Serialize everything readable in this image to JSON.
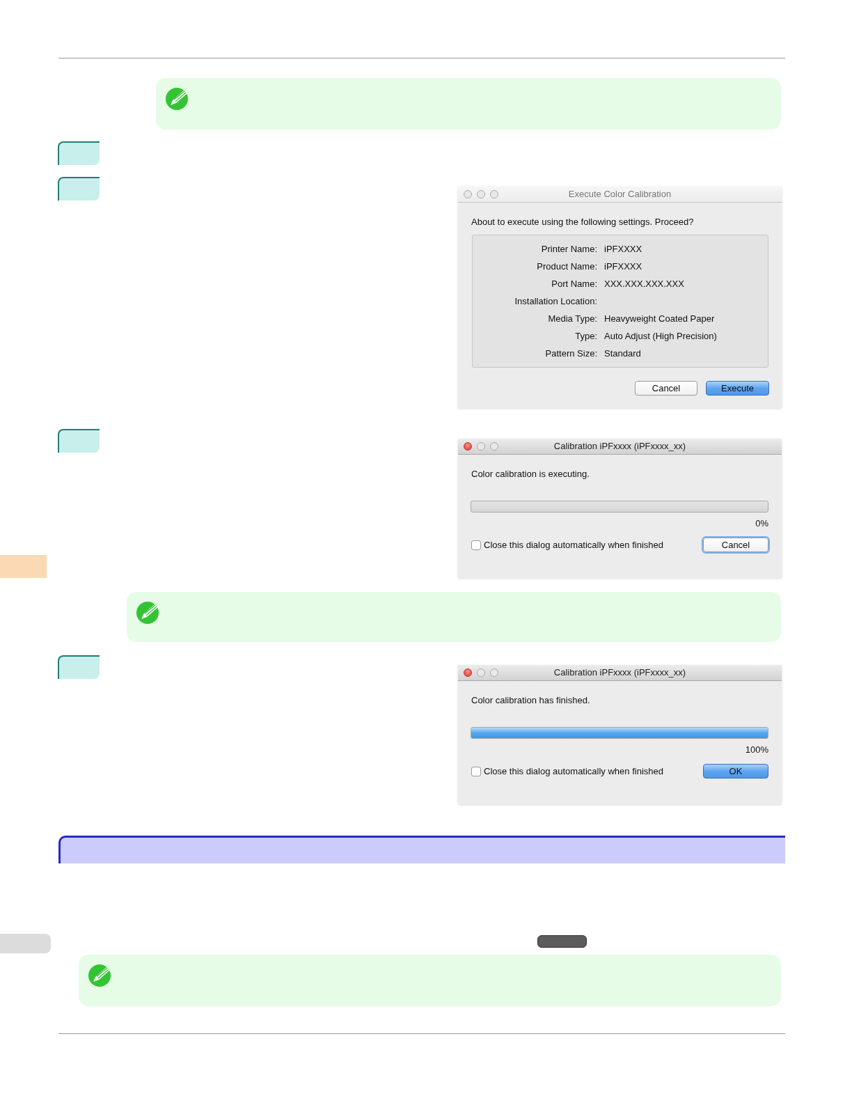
{
  "dialogs": [
    {
      "kind": "confirm",
      "title": "Execute Color Calibration",
      "active": false,
      "message": "About to execute using the following settings. Proceed?",
      "settings": [
        {
          "label": "Printer Name:",
          "value": "iPFXXXX"
        },
        {
          "label": "Product Name:",
          "value": "iPFXXXX"
        },
        {
          "label": "Port Name:",
          "value": "XXX.XXX.XXX.XXX"
        },
        {
          "label": "Installation Location:"
        },
        {
          "label": "Media Type:",
          "value": "Heavyweight Coated Paper"
        },
        {
          "label": "Type:",
          "value": "Auto Adjust (High Precision)"
        },
        {
          "label": "Pattern Size:",
          "value": "Standard"
        }
      ],
      "buttons": [
        {
          "label": "Cancel",
          "default": false,
          "focused": false
        },
        {
          "label": "Execute",
          "default": true,
          "focused": false
        }
      ]
    },
    {
      "kind": "progress",
      "title": "Calibration iPFxxxx (iPFxxxx_xx)",
      "active": true,
      "message": "Color calibration is executing.",
      "level": 0,
      "reading": "0%",
      "checkbox": {
        "label": "Close this dialog automatically when finished",
        "checked": false
      },
      "buttons": [
        {
          "label": "Cancel",
          "default": false,
          "focused": true
        }
      ]
    },
    {
      "kind": "progress",
      "title": "Calibration iPFxxxx (iPFxxxx_xx)",
      "active": true,
      "message": "Color calibration has finished.",
      "level": 1,
      "reading": "100%",
      "checkbox": {
        "label": "Close this dialog automatically when finished",
        "checked": false
      },
      "buttons": [
        {
          "label": "OK",
          "default": true,
          "focused": false
        }
      ]
    }
  ]
}
